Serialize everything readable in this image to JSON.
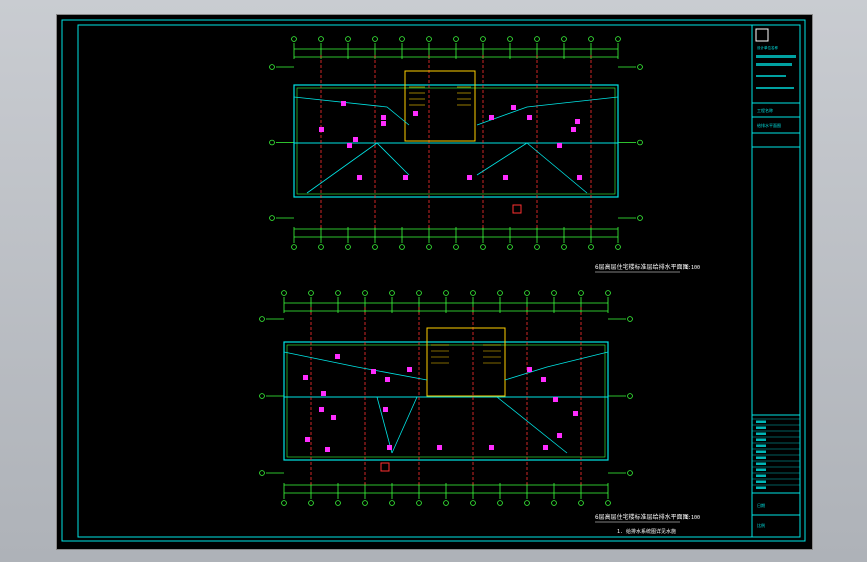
{
  "drawing": {
    "plan_upper_title": "6层高层住宅楼标准层给排水平面图",
    "plan_upper_scale": "1:100",
    "plan_lower_title": "6层高层住宅楼标准层给排水平面图",
    "plan_lower_scale": "1:100",
    "note": "1. 给排水系统图详见水施"
  },
  "title_block": {
    "lines": [
      "设计单位名称",
      "工程名称",
      "给排水平面图",
      "审定",
      "审核",
      "设计",
      "制图",
      "校对",
      "图号",
      "日期",
      "比例"
    ]
  },
  "colors": {
    "background": "#000000",
    "frame": "#00e5e5",
    "walls": "#3cff3c",
    "axis": "#ff3030",
    "fixtures": "#ff2dff",
    "stair": "#ffd000"
  }
}
